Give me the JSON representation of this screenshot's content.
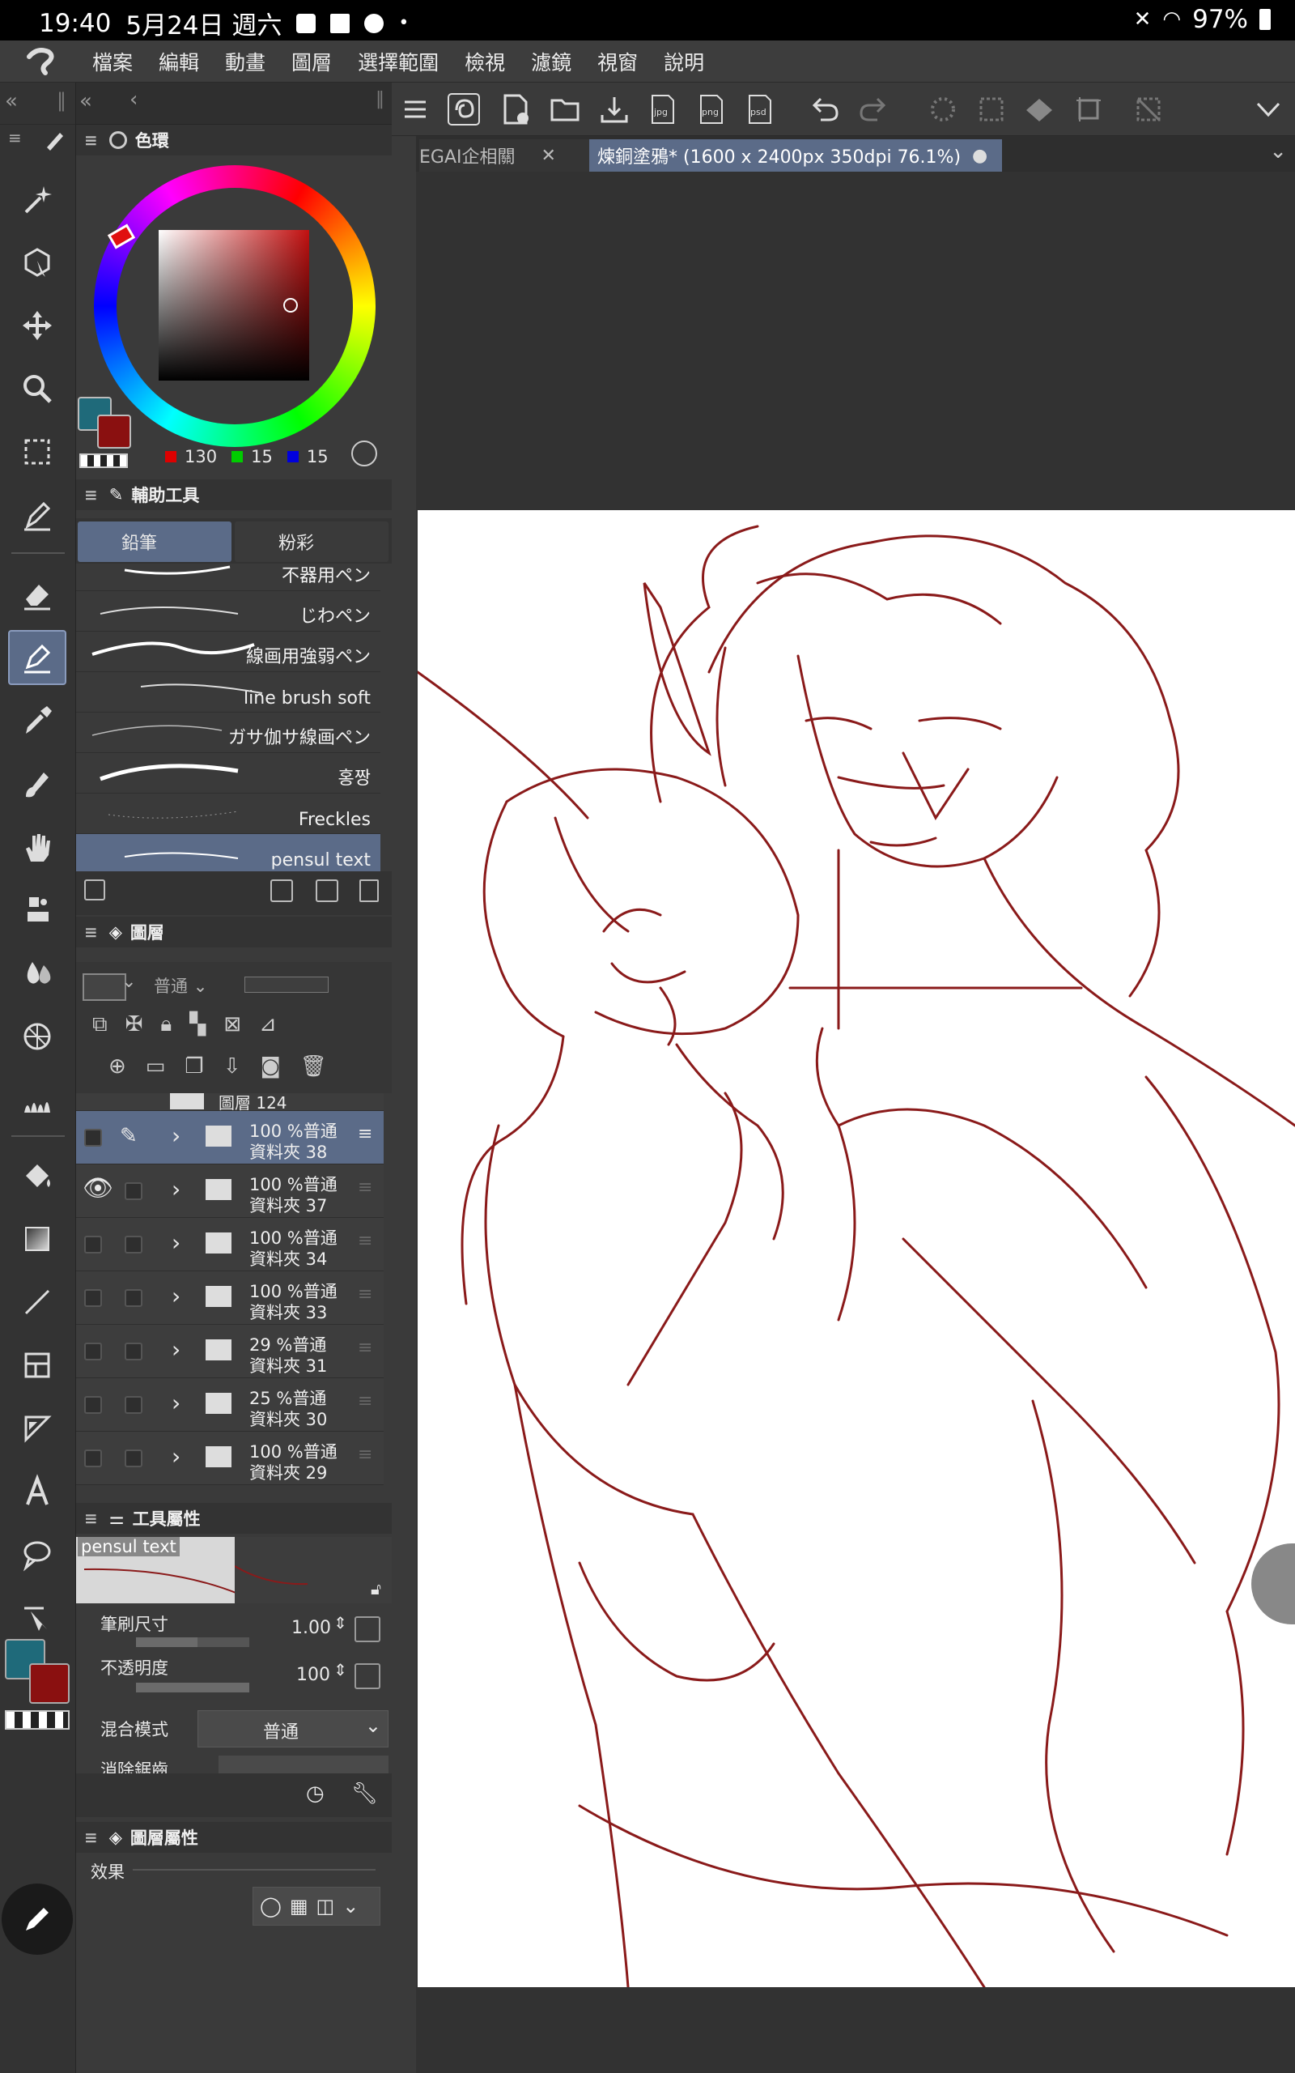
{
  "status": {
    "time": "19:40",
    "date": "5月24日 週六",
    "battery": "97%"
  },
  "menu": [
    "檔案",
    "編輯",
    "動畫",
    "圖層",
    "選擇範圍",
    "檢視",
    "濾鏡",
    "視窗",
    "說明"
  ],
  "color_wheel": {
    "title": "色環",
    "r": "130",
    "g": "15",
    "b": "15",
    "main_color": "#1f6a7a",
    "sub_color": "#8a1010"
  },
  "sub_tool": {
    "title": "輔助工具",
    "tabs": [
      "鉛筆",
      "粉彩"
    ],
    "brushes": [
      "不器用ペン",
      "じわペン",
      "線画用強弱ペン",
      "line brush soft",
      "ガサ伽サ線画ペン",
      "홍짱",
      "Freckles",
      "pensul text"
    ]
  },
  "layers": {
    "title": "圖層",
    "blend": "普通",
    "top_layer": "圖層 124",
    "rows": [
      {
        "opacity": "100 %普通",
        "name": "資料夾 38"
      },
      {
        "opacity": "100 %普通",
        "name": "資料夾 37"
      },
      {
        "opacity": "100 %普通",
        "name": "資料夾 34"
      },
      {
        "opacity": "100 %普通",
        "name": "資料夾 33"
      },
      {
        "opacity": "29 %普通",
        "name": "資料夾 31"
      },
      {
        "opacity": "25 %普通",
        "name": "資料夾 30"
      },
      {
        "opacity": "100 %普通",
        "name": "資料夾 29"
      }
    ]
  },
  "tool_property": {
    "title": "工具屬性",
    "preview_name": "pensul text",
    "brush_size_label": "筆刷尺寸",
    "brush_size": "1.00",
    "opacity_label": "不透明度",
    "opacity": "100",
    "blend_label": "混合模式",
    "blend": "普通",
    "aa_label": "消除鋸齒"
  },
  "layer_property": {
    "title": "圖層屬性",
    "effect_label": "效果"
  },
  "tabs": {
    "tab1": "EGAI企相關",
    "tab2": "煉銅塗鴉* (1600 x 2400px 350dpi 76.1%)"
  },
  "colors": {
    "accent": "#5b6b88",
    "line": "#8a1a1a"
  }
}
